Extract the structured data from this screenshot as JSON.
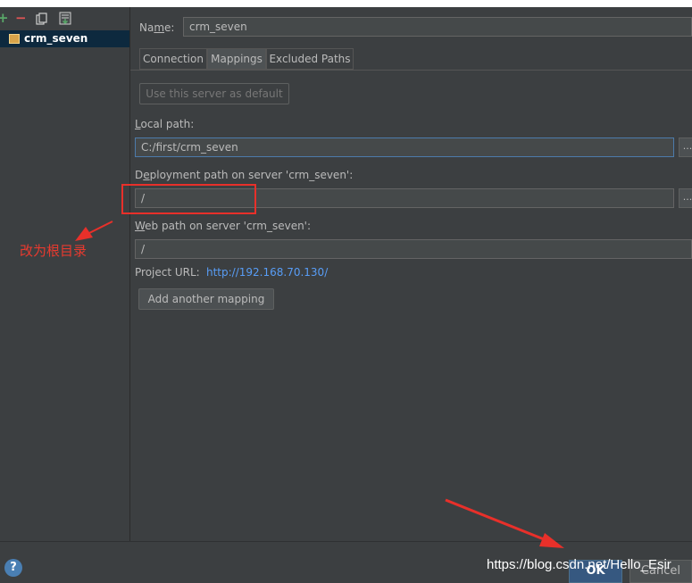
{
  "toolbar": {
    "add_icon": "+",
    "remove_icon": "−",
    "copy_icon": "copy-icon",
    "import_icon": "import-icon"
  },
  "servers": [
    {
      "name": "crm_seven"
    }
  ],
  "form": {
    "name_label_pre": "Na",
    "name_label_mn": "m",
    "name_label_post": "e:",
    "name_value": "crm_seven",
    "tabs": [
      "Connection",
      "Mappings",
      "Excluded Paths"
    ],
    "active_tab": "Mappings",
    "default_button": "Use this server as default",
    "local_path_label_mn": "L",
    "local_path_label_rest": "ocal path:",
    "local_path_value": "C:/first/crm_seven",
    "deploy_label_pre": "D",
    "deploy_label_mn": "e",
    "deploy_label_rest": "ployment path on server 'crm_seven':",
    "deploy_value": "/",
    "web_label_mn": "W",
    "web_label_rest": "eb path on server 'crm_seven':",
    "web_value": "/",
    "project_url_label": "Project URL:",
    "project_url_value": "http://192.168.70.130/",
    "add_mapping_pre": "A",
    "add_mapping_mn": "d",
    "add_mapping_rest": "d another mapping",
    "browse_label": "..."
  },
  "annotation": {
    "text": "改为根目录",
    "color": "#e8302a"
  },
  "footer": {
    "help": "?",
    "ok": "OK",
    "cancel": "Cancel",
    "watermark": "https://blog.csdn.net/Hello_Esir"
  },
  "colors": {
    "background": "#3c3f41",
    "selection": "#0d293e",
    "link": "#589df6",
    "focus_border": "#4c7bab",
    "annotation": "#e8302a"
  }
}
